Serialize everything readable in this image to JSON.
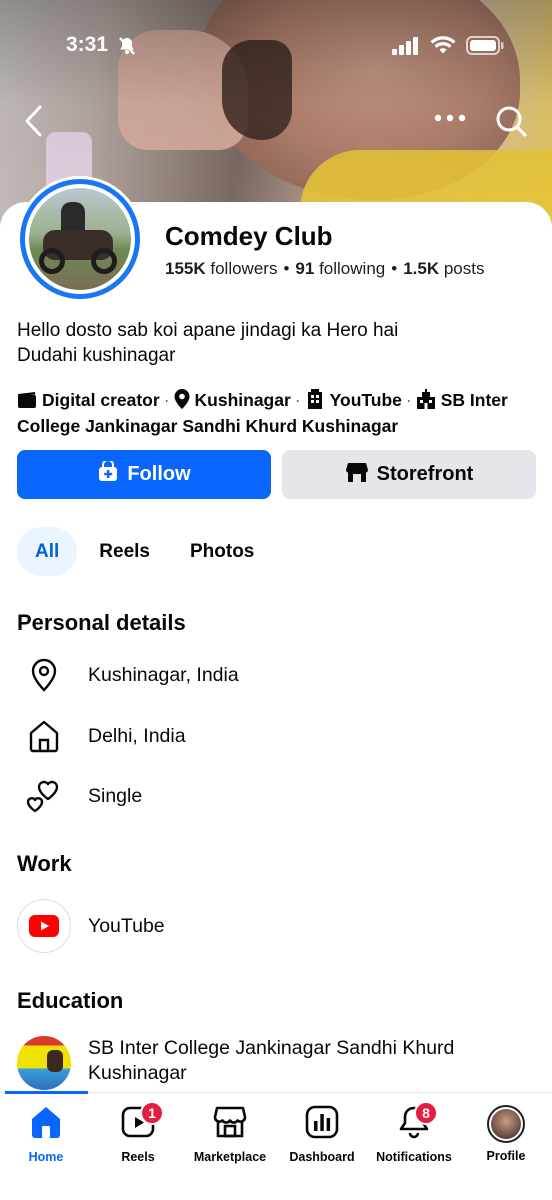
{
  "status_bar": {
    "time": "3:31"
  },
  "profile": {
    "name": "Comdey Club",
    "followers_count": "155K",
    "followers_label": "followers",
    "following_count": "91",
    "following_label": "following",
    "posts_count": "1.5K",
    "posts_label": "posts",
    "bio_line1": "Hello dosto sab koi apane jindagi ka Hero hai",
    "bio_line2": "Dudahi kushinagar",
    "category": "Digital creator",
    "location": "Kushinagar",
    "work": "YouTube",
    "school": "SB Inter College Jankinagar Sandhi Khurd Kushinagar",
    "school_prefix": "SB",
    "school_rest": "Inter College Jankinagar Sandhi Khurd Kushinagar"
  },
  "actions": {
    "follow_label": "Follow",
    "storefront_label": "Storefront"
  },
  "tabs": [
    {
      "label": "All",
      "active": true
    },
    {
      "label": "Reels",
      "active": false
    },
    {
      "label": "Photos",
      "active": false
    }
  ],
  "personal_details": {
    "title": "Personal details",
    "items": [
      {
        "icon": "location-pin-icon",
        "text": "Kushinagar, India"
      },
      {
        "icon": "home-icon",
        "text": "Delhi, India"
      },
      {
        "icon": "hearts-icon",
        "text": "Single"
      }
    ]
  },
  "work": {
    "title": "Work",
    "items": [
      {
        "icon": "youtube-logo-icon",
        "text": "YouTube"
      }
    ]
  },
  "education": {
    "title": "Education",
    "items": [
      {
        "line1": "SB Inter College Jankinagar Sandhi Khurd",
        "line2": "Kushinagar"
      }
    ]
  },
  "bottom_nav": [
    {
      "label": "Home",
      "icon": "home-icon",
      "active": true
    },
    {
      "label": "Reels",
      "icon": "reels-icon",
      "badge": "1"
    },
    {
      "label": "Marketplace",
      "icon": "marketplace-icon"
    },
    {
      "label": "Dashboard",
      "icon": "dashboard-icon"
    },
    {
      "label": "Notifications",
      "icon": "bell-icon",
      "badge": "8"
    },
    {
      "label": "Profile",
      "icon": "profile-avatar"
    }
  ],
  "colors": {
    "accent": "#0866ff",
    "badge": "#e41e3f",
    "tab_active_bg": "#ebf5ff",
    "secondary_button": "#e4e6eb"
  }
}
